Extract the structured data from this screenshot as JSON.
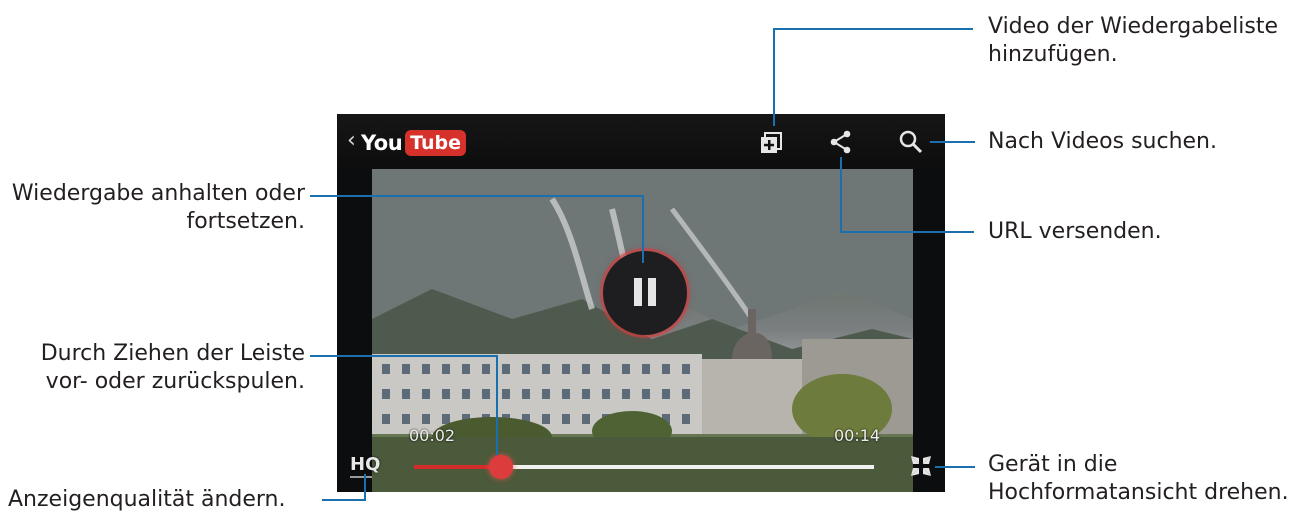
{
  "callouts": {
    "playlist": [
      "Video der Wiedergabeliste",
      "hinzufügen."
    ],
    "search": "Nach Videos suchen.",
    "pause": [
      "Wiedergabe anhalten oder",
      "fortsetzen."
    ],
    "share": "URL versenden.",
    "seek": [
      "Durch Ziehen der Leiste",
      "vor- oder zurückspulen."
    ],
    "rotate": [
      "Gerät in die",
      "Hochformatansicht drehen."
    ],
    "quality": "Anzeigenqualität ändern."
  },
  "player": {
    "back_glyph": "‹",
    "logo_you": "You",
    "logo_tube": "Tube",
    "elapsed": "00:02",
    "duration": "00:14",
    "progress_fraction": 0.19,
    "quality_label": "HQ"
  },
  "colors": {
    "leader": "#1a6fae",
    "progress": "#d42b2b",
    "youtube_red": "#d6312b"
  },
  "icons": [
    "back-chevron-icon",
    "add-to-playlist-icon",
    "share-icon",
    "search-icon",
    "pause-icon",
    "shrink-screen-icon"
  ]
}
